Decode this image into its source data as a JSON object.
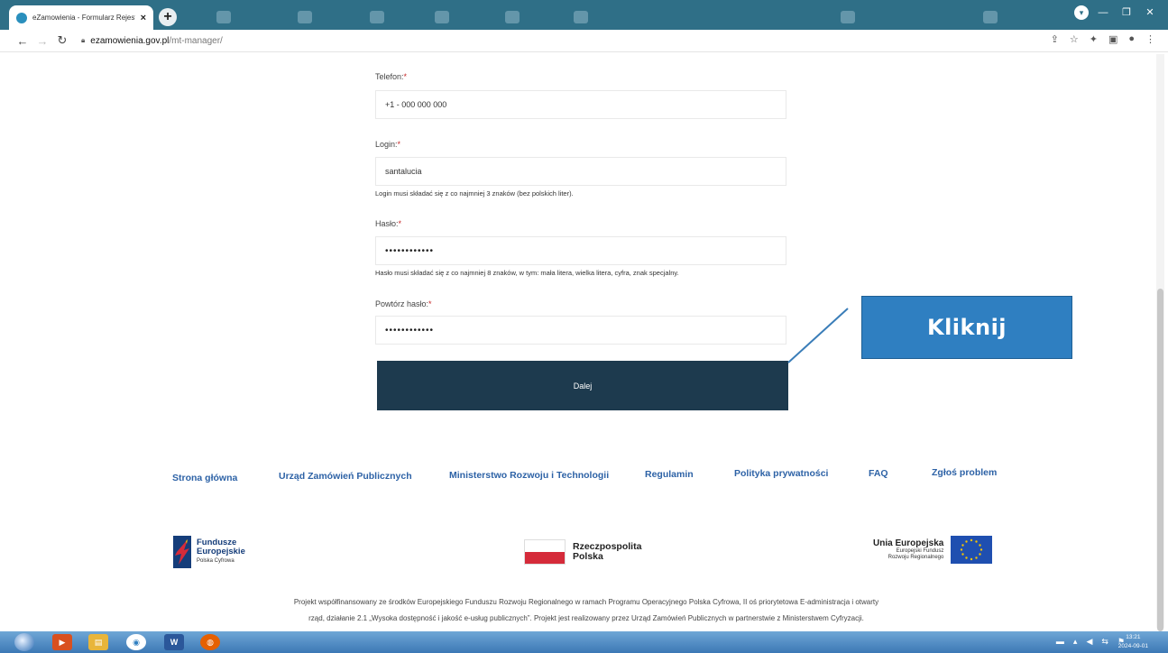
{
  "browser": {
    "tab_title": "eZamowienia - Formularz Rejest",
    "tab_close": "×",
    "newtab": "+",
    "url_host": "ezamowienia.gov.pl",
    "url_path": "/mt-manager/"
  },
  "form": {
    "phone_label": "Telefon:",
    "phone_value": "+1 - 000 000 000",
    "login_label": "Login:",
    "login_value": "santalucia",
    "login_hint": "Login musi składać się z co najmniej 3 znaków (bez polskich liter).",
    "password_label": "Hasło:",
    "password_value": "••••••••••••",
    "password_hint": "Hasło musi składać się z co najmniej 8 znaków, w tym: mała litera, wielka litera, cyfra, znak specjalny.",
    "repeat_label": "Powtórz hasło:",
    "repeat_value": "••••••••••••",
    "required_mark": "*",
    "submit_label": "Dalej"
  },
  "callout": {
    "text": "Kliknij"
  },
  "footer": {
    "links": [
      "Strona główna",
      "Urząd Zamówień Publicznych",
      "Ministerstwo Rozwoju i Technologii",
      "Regulamin",
      "Polityka prywatności",
      "FAQ",
      "Zgłoś problem"
    ],
    "logo_fe": {
      "line1": "Fundusze",
      "line2": "Europejskie",
      "sub": "Polska Cyfrowa"
    },
    "logo_rp": {
      "line1": "Rzeczpospolita",
      "line2": "Polska"
    },
    "logo_ue": {
      "title": "Unia Europejska",
      "sub1": "Europejski Fundusz",
      "sub2": "Rozwoju Regionalnego"
    },
    "disclaimer_line1": "Projekt współfinansowany ze środków Europejskiego Funduszu Rozwoju Regionalnego w ramach Programu Operacyjnego Polska Cyfrowa, II oś priorytetowa E-administracja i otwarty",
    "disclaimer_line2": "rząd, działanie 2.1 „Wysoka dostępność i jakość e-usług publicznych”. Projekt jest realizowany przez Urząd Zamówień Publicznych w partnerstwie z Ministerstwem Cyfryzacji."
  },
  "taskbar": {
    "word_label": "W",
    "clock_time": "13:21",
    "clock_date": "2024-09-01"
  },
  "colors": {
    "submit_bg": "#1d3a4e",
    "callout_bg": "#2f7fc1",
    "link": "#2d62a6",
    "required": "#c62828"
  }
}
